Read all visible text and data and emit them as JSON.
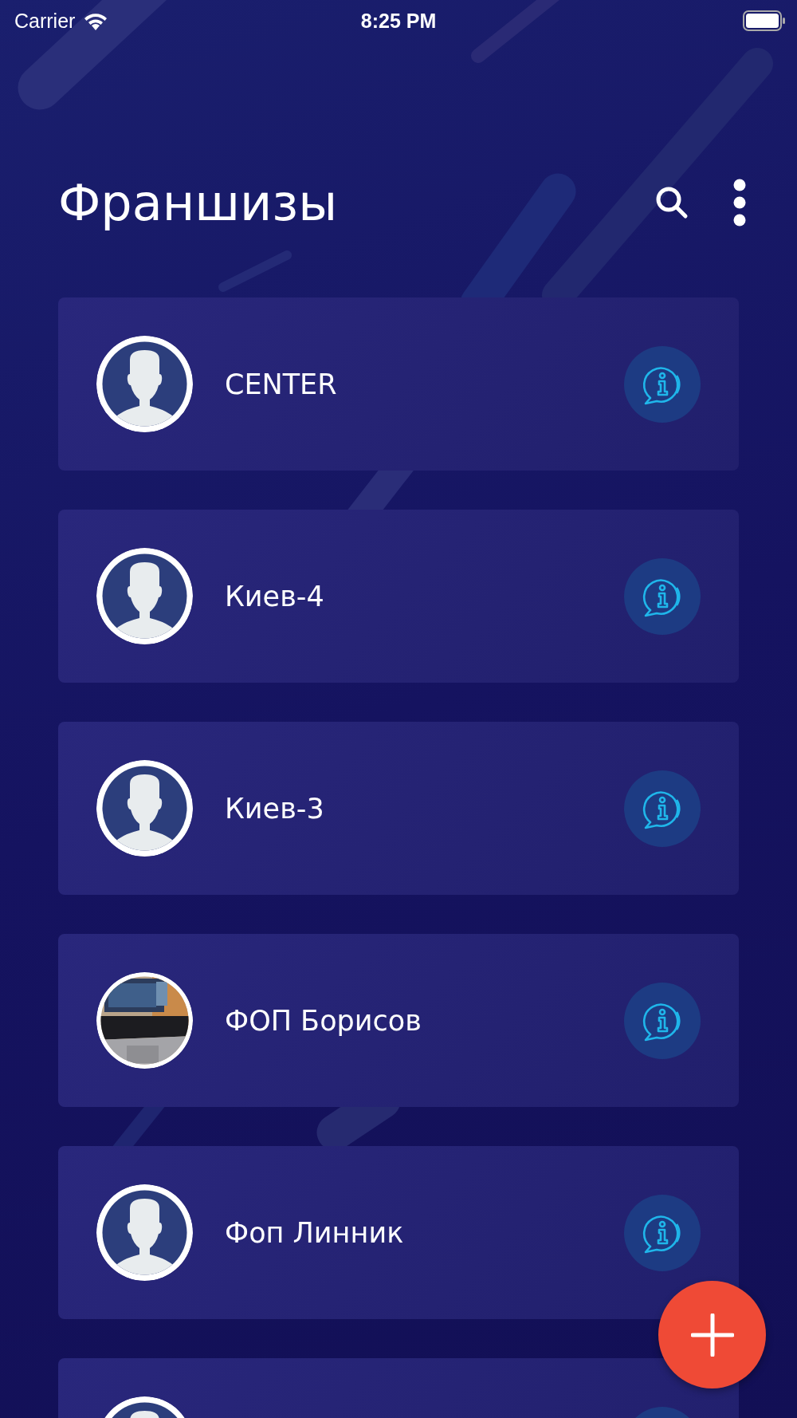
{
  "status_bar": {
    "carrier": "Carrier",
    "time": "8:25 PM"
  },
  "header": {
    "title": "Франшизы"
  },
  "franchises": [
    {
      "name": "CENTER",
      "kind": "avatar"
    },
    {
      "name": "Киев-4",
      "kind": "avatar"
    },
    {
      "name": "Киев-3",
      "kind": "avatar"
    },
    {
      "name": "ФОП Борисов"
    },
    {
      "name": "Фоп Линник",
      "kind": "avatar"
    },
    {
      "kind": "avatar"
    }
  ]
}
